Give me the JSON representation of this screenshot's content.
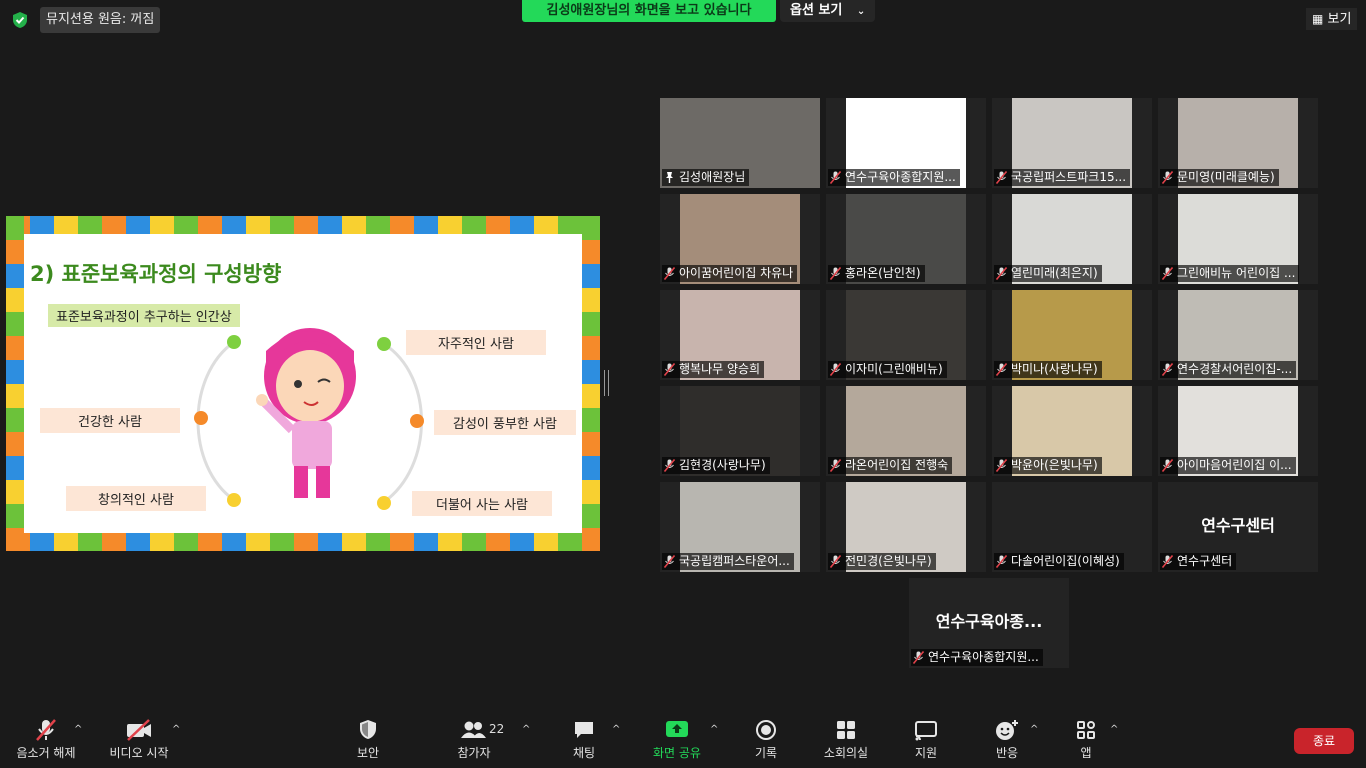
{
  "top": {
    "audio_status": "뮤지션용 원음: 꺼짐",
    "share_banner": "김성애원장님의 화면을 보고 있습니다",
    "view_options": "옵션 보기",
    "view_button": "보기"
  },
  "slide": {
    "title": "2) 표준보육과정의 구성방향",
    "subtitle": "표준보육과정이 추구하는 인간상",
    "items": {
      "autonomous": "자주적인 사람",
      "healthy": "건강한 사람",
      "emotional": "감성이 풍부한 사람",
      "creative": "창의적인 사람",
      "together": "더불어 사는 사람"
    }
  },
  "participants": [
    {
      "name": "김성애원장님",
      "muted": false,
      "active": true,
      "video": true,
      "photo_color": "#6d6a66"
    },
    {
      "name": "연수구육아종합지원...",
      "muted": true,
      "video": true,
      "photo_color": "#ffffff"
    },
    {
      "name": "국공립퍼스트파크15...",
      "muted": true,
      "video": true,
      "photo_color": "#c9c6c2"
    },
    {
      "name": "문미영(미래클예능)",
      "muted": true,
      "video": true,
      "photo_color": "#b7b0aa"
    },
    {
      "name": "아이꿈어린이집 차유나",
      "muted": true,
      "video": true,
      "photo_color": "#a48d7a"
    },
    {
      "name": "홍라온(남인천)",
      "muted": true,
      "video": true,
      "photo_color": "#4a4a48"
    },
    {
      "name": "열린미래(최은지)",
      "muted": true,
      "video": true,
      "photo_color": "#d9d9d6"
    },
    {
      "name": "그린애비뉴 어린이집 ...",
      "muted": true,
      "video": true,
      "photo_color": "#dcdcd8"
    },
    {
      "name": "행복나무 양승희",
      "muted": true,
      "video": true,
      "photo_color": "#c8b4ad"
    },
    {
      "name": "이자미(그린애비뉴)",
      "muted": true,
      "video": true,
      "photo_color": "#3a3835"
    },
    {
      "name": "박미나(사랑나무)",
      "muted": true,
      "video": true,
      "photo_color": "#b79a4a"
    },
    {
      "name": "연수경찰서어린이집-...",
      "muted": true,
      "video": true,
      "photo_color": "#bfbcb5"
    },
    {
      "name": "김현경(사랑나무)",
      "muted": true,
      "video": true,
      "photo_color": "#2f2d2b"
    },
    {
      "name": "라온어린이집 전행숙",
      "muted": true,
      "video": true,
      "photo_color": "#b4a89b"
    },
    {
      "name": "박윤아(은빛나무)",
      "muted": true,
      "video": true,
      "photo_color": "#d8c8a8"
    },
    {
      "name": "아이마음어린이집 이...",
      "muted": true,
      "video": true,
      "photo_color": "#e2e0dc"
    },
    {
      "name": "국공립캠퍼스타운어...",
      "muted": true,
      "video": true,
      "photo_color": "#b8b6b0"
    },
    {
      "name": "전민경(은빛나무)",
      "muted": true,
      "video": true,
      "photo_color": "#cfcac4"
    },
    {
      "name": "다솔어린이집(이혜성)",
      "muted": true,
      "video": false
    },
    {
      "name": "연수구센터",
      "muted": true,
      "video": false,
      "display": "연수구센터"
    },
    {
      "name": "연수구육아종합지원...",
      "muted": true,
      "video": false,
      "display": "연수구육아종..."
    }
  ],
  "toolbar": {
    "unmute": "음소거 해제",
    "start_video": "비디오 시작",
    "security": "보안",
    "participants": "참가자",
    "participant_count": "22",
    "chat": "채팅",
    "share_screen": "화면 공유",
    "record": "기록",
    "breakout": "소회의실",
    "support": "지원",
    "reactions": "반응",
    "apps": "앱",
    "end": "종료"
  },
  "colors": {
    "share_green": "#23d959",
    "active_border": "#e8e35a",
    "end_red": "#c9242b",
    "slide_title_green": "#3c8a1e"
  }
}
